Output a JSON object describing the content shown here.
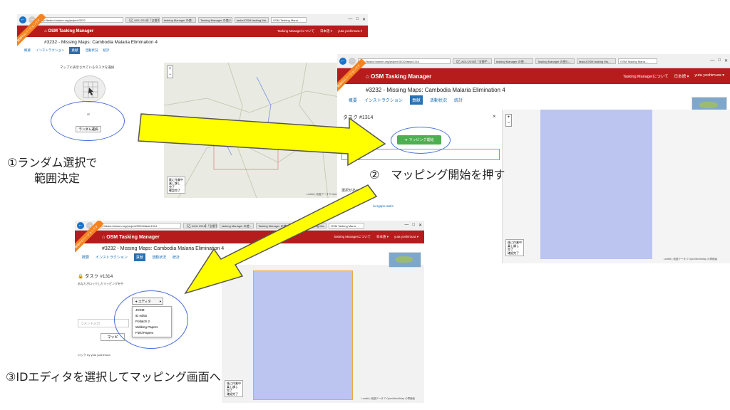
{
  "browser": {
    "address_1": "http://tasks.hotosm.org/project/3232",
    "address_2": "http://tasks.hotosm.org/project/3232#task/1314",
    "address_3": "http://tasks.hotosm.org/project/3232#task/1314",
    "tabs": [
      "【乙 AGU 2016】「全層手…",
      "tasking Manager の使…",
      "Tasking Manager の使い…",
      "tasksJOSM tasking Ma…",
      "OSM Tasking Mana…"
    ],
    "controls": [
      "—",
      "□",
      "✕"
    ]
  },
  "app": {
    "brand": "OSM Tasking Manager",
    "nav_about": "Tasking Managerについて",
    "nav_lang": "日本語 ▾",
    "nav_user": "yuta yoshimura ▾",
    "project_title": "#3232 - Missing Maps: Cambodia Malaria Elimination 4",
    "tabs": [
      "概要",
      "インストラクション",
      "貢献",
      "活動状況",
      "統計"
    ],
    "ribbon": "開発中のバージョンです"
  },
  "panel1": {
    "heading": "マップに表示されているタスクを選択",
    "or": "or",
    "random_button": "ランダム選択"
  },
  "panel2": {
    "task_title": "タスク #1314",
    "close": "×",
    "start_button": "マッピング開始",
    "locked_msg": "選択があ〜ません",
    "link": "ivergaps tasks"
  },
  "panel3": {
    "task_title": "タスク #1314",
    "lock_msg": "あなたがロックしたマッピングを中",
    "editor_button": "エディタ",
    "editor_options": [
      "JOSM",
      "iD editor",
      "Potlatch 2",
      "Walking Papers",
      "Field Papers"
    ],
    "comment_placeholder": "コメント入力",
    "mapping_btn": "マッピ",
    "locked_by": "ロック by yuta yoshimura"
  },
  "map_legend": [
    "既に作業中",
    "乗し課し",
    "完了",
    "確認完了"
  ],
  "map_credit": "Leaflet | 地図データ © OpenStreetMap の寄稿者",
  "annotations": {
    "step1_line1": "①ランダム選択で",
    "step1_line2": "範囲決定",
    "step2": "②　マッピング開始を押す",
    "step3": "③IDエディタを選択してマッピング画面へ"
  },
  "colors": {
    "navbar": "#b71c1c",
    "arrow_fill": "#ffff00",
    "arrow_stroke": "#555555",
    "oval": "#4a6fd6",
    "task_area": "#bcc4f0"
  }
}
